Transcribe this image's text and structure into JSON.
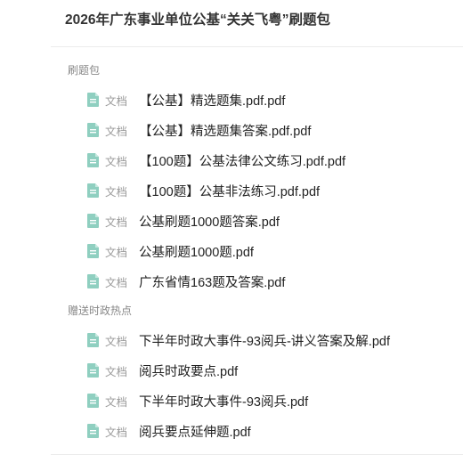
{
  "header": {
    "title": "2026年广东事业单位公基“关关飞粤”刷题包"
  },
  "theme": {
    "icon_color": "#8fcfc0",
    "divider_color": "#ebebeb"
  },
  "sections": [
    {
      "label": "刷题包",
      "items": [
        {
          "icon": "document-icon",
          "type": "文档",
          "name": "【公基】精选题集.pdf.pdf"
        },
        {
          "icon": "document-icon",
          "type": "文档",
          "name": "【公基】精选题集答案.pdf.pdf"
        },
        {
          "icon": "document-icon",
          "type": "文档",
          "name": "【100题】公基法律公文练习.pdf.pdf"
        },
        {
          "icon": "document-icon",
          "type": "文档",
          "name": "【100题】公基非法练习.pdf.pdf"
        },
        {
          "icon": "document-icon",
          "type": "文档",
          "name": "公基刷题1000题答案.pdf"
        },
        {
          "icon": "document-icon",
          "type": "文档",
          "name": "公基刷题1000题.pdf"
        },
        {
          "icon": "document-icon",
          "type": "文档",
          "name": "广东省情163题及答案.pdf"
        }
      ]
    },
    {
      "label": "赠送时政热点",
      "items": [
        {
          "icon": "document-icon",
          "type": "文档",
          "name": "下半年时政大事件-93阅兵-讲义答案及解.pdf"
        },
        {
          "icon": "document-icon",
          "type": "文档",
          "name": "阅兵时政要点.pdf"
        },
        {
          "icon": "document-icon",
          "type": "文档",
          "name": "下半年时政大事件-93阅兵.pdf"
        },
        {
          "icon": "document-icon",
          "type": "文档",
          "name": "阅兵要点延伸题.pdf"
        }
      ]
    }
  ]
}
